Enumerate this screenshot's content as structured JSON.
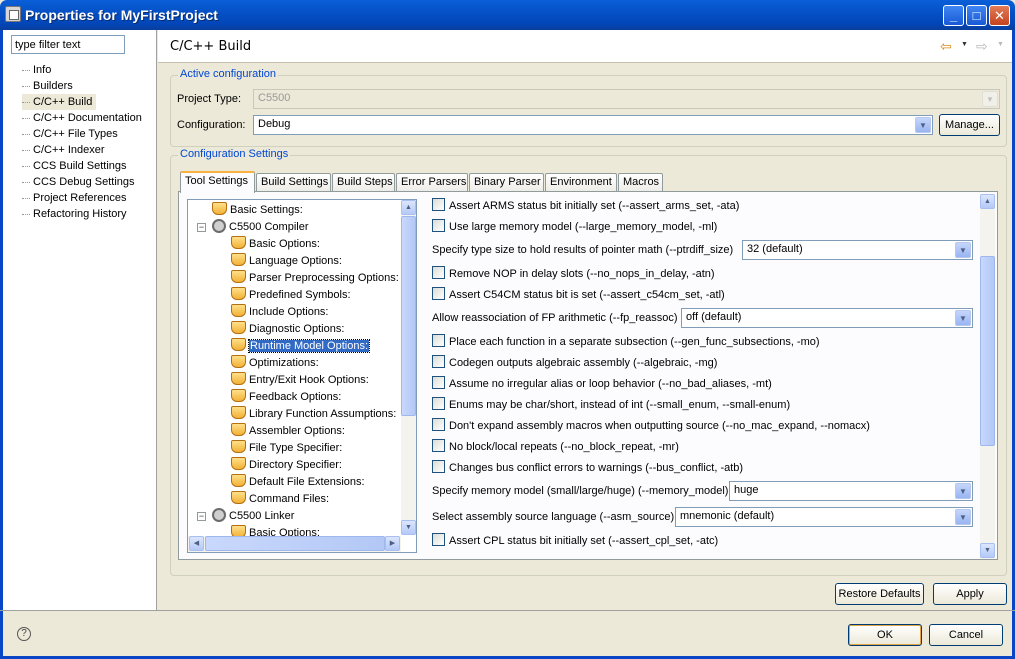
{
  "window": {
    "title": "Properties for MyFirstProject",
    "icon": "properties-icon",
    "minimize_label": "_",
    "maximize_label": "□",
    "close_label": "✕"
  },
  "sidebar": {
    "filter_placeholder": "type filter text",
    "filter_value": "type filter text",
    "items": [
      {
        "label": "Info"
      },
      {
        "label": "Builders"
      },
      {
        "label": "C/C++ Build",
        "selected": true
      },
      {
        "label": "C/C++ Documentation"
      },
      {
        "label": "C/C++ File Types"
      },
      {
        "label": "C/C++ Indexer"
      },
      {
        "label": "CCS Build Settings"
      },
      {
        "label": "CCS Debug Settings"
      },
      {
        "label": "Project References"
      },
      {
        "label": "Refactoring History"
      }
    ]
  },
  "page": {
    "title": "C/C++ Build",
    "back_icon": "⇦",
    "forward_icon": "⇨",
    "dropdown_icon": "▼"
  },
  "active_config": {
    "group_title": "Active configuration",
    "project_type_label": "Project Type:",
    "project_type_value": "C5500",
    "configuration_label": "Configuration:",
    "configuration_value": "Debug",
    "manage_label": "Manage..."
  },
  "config_settings": {
    "group_title": "Configuration Settings",
    "tabs": [
      {
        "label": "Tool Settings",
        "active": true
      },
      {
        "label": "Build Settings"
      },
      {
        "label": "Build Steps"
      },
      {
        "label": "Error Parsers"
      },
      {
        "label": "Binary Parser"
      },
      {
        "label": "Environment"
      },
      {
        "label": "Macros"
      }
    ]
  },
  "tool_tree": [
    {
      "label": "Basic Settings:",
      "level": 1,
      "icon": "folder-icon"
    },
    {
      "label": "C5500 Compiler",
      "level": 1,
      "icon": "gear-icon",
      "expander": "−"
    },
    {
      "label": "Basic Options:",
      "level": 2,
      "icon": "folder-icon"
    },
    {
      "label": "Language Options:",
      "level": 2,
      "icon": "folder-icon"
    },
    {
      "label": "Parser Preprocessing Options:",
      "level": 2,
      "icon": "folder-icon"
    },
    {
      "label": "Predefined Symbols:",
      "level": 2,
      "icon": "folder-icon"
    },
    {
      "label": "Include Options:",
      "level": 2,
      "icon": "folder-icon"
    },
    {
      "label": "Diagnostic Options:",
      "level": 2,
      "icon": "folder-icon"
    },
    {
      "label": "Runtime Model Options:",
      "level": 2,
      "icon": "folder-icon",
      "selected": true
    },
    {
      "label": "Optimizations:",
      "level": 2,
      "icon": "folder-icon"
    },
    {
      "label": "Entry/Exit Hook Options:",
      "level": 2,
      "icon": "folder-icon"
    },
    {
      "label": "Feedback Options:",
      "level": 2,
      "icon": "folder-icon"
    },
    {
      "label": "Library Function Assumptions:",
      "level": 2,
      "icon": "folder-icon"
    },
    {
      "label": "Assembler Options:",
      "level": 2,
      "icon": "folder-icon"
    },
    {
      "label": "File Type Specifier:",
      "level": 2,
      "icon": "folder-icon"
    },
    {
      "label": "Directory Specifier:",
      "level": 2,
      "icon": "folder-icon"
    },
    {
      "label": "Default File Extensions:",
      "level": 2,
      "icon": "folder-icon"
    },
    {
      "label": "Command Files:",
      "level": 2,
      "icon": "folder-icon"
    },
    {
      "label": "C5500 Linker",
      "level": 1,
      "icon": "gear-icon",
      "expander": "−"
    },
    {
      "label": "Basic Options:",
      "level": 2,
      "icon": "folder-icon"
    }
  ],
  "options": [
    {
      "type": "checkbox",
      "label": "Assert ARMS status bit initially set (--assert_arms_set, -ata)",
      "checked": false
    },
    {
      "type": "checkbox",
      "label": "Use large memory model (--large_memory_model, -ml)",
      "checked": false
    },
    {
      "type": "combo",
      "label": "Specify type size to hold results of pointer math (--ptrdiff_size)",
      "value": "32 (default)"
    },
    {
      "type": "checkbox",
      "label": "Remove NOP in delay slots (--no_nops_in_delay, -atn)",
      "checked": false
    },
    {
      "type": "checkbox",
      "label": "Assert C54CM status bit is set (--assert_c54cm_set, -atl)",
      "checked": false
    },
    {
      "type": "combo",
      "label": "Allow reassociation of FP arithmetic (--fp_reassoc)",
      "value": "off (default)"
    },
    {
      "type": "checkbox",
      "label": "Place each function in a separate subsection (--gen_func_subsections, -mo)",
      "checked": false
    },
    {
      "type": "checkbox",
      "label": "Codegen outputs algebraic assembly (--algebraic, -mg)",
      "checked": false
    },
    {
      "type": "checkbox",
      "label": "Assume no irregular alias or loop behavior (--no_bad_aliases, -mt)",
      "checked": false
    },
    {
      "type": "checkbox",
      "label": "Enums may be char/short, instead of int (--small_enum, --small-enum)",
      "checked": false
    },
    {
      "type": "checkbox",
      "label": "Don't expand assembly macros when outputting source (--no_mac_expand, --nomacx)",
      "checked": false
    },
    {
      "type": "checkbox",
      "label": "No block/local repeats (--no_block_repeat, -mr)",
      "checked": false
    },
    {
      "type": "checkbox",
      "label": "Changes bus conflict errors to warnings (--bus_conflict, -atb)",
      "checked": false
    },
    {
      "type": "combo",
      "label": "Specify memory model (small/large/huge) (--memory_model)",
      "value": "huge"
    },
    {
      "type": "combo",
      "label": "Select assembly source language (--asm_source)",
      "value": "mnemonic (default)"
    },
    {
      "type": "checkbox",
      "label": "Assert CPL status bit initially set (--assert_cpl_set, -atc)",
      "checked": false
    }
  ],
  "buttons": {
    "restore_defaults": "Restore Defaults",
    "apply": "Apply",
    "ok": "OK",
    "cancel": "Cancel",
    "help_icon": "?"
  },
  "colors": {
    "titlebar": "#0551c7",
    "group_title": "#0046d5",
    "selection": "#316ac5",
    "background": "#ece9d8"
  }
}
